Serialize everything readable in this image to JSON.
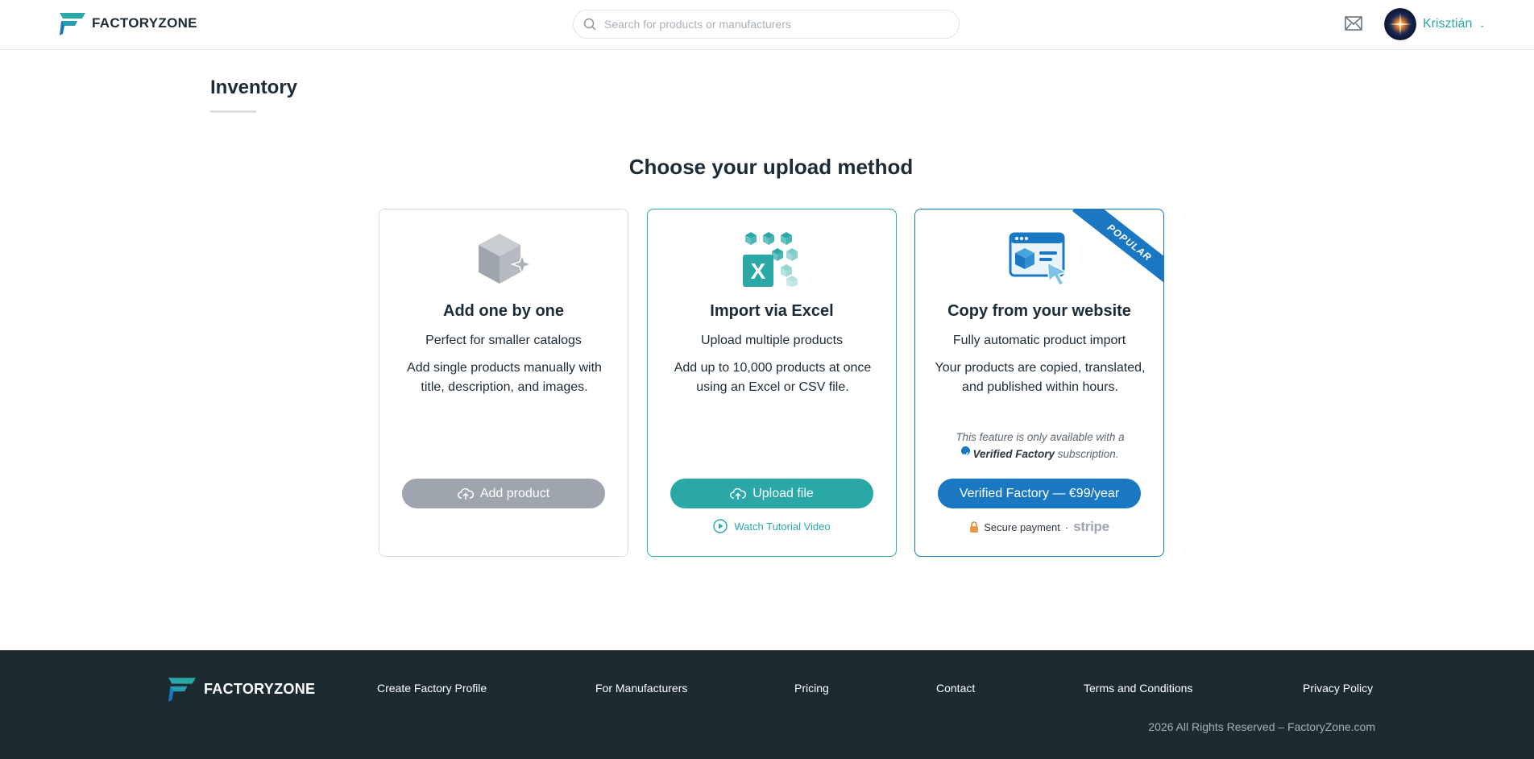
{
  "header": {
    "logo_text": "FACTORYZONE",
    "search_placeholder": "Search for products or manufacturers",
    "user_name": "Krisztián"
  },
  "page": {
    "title": "Inventory",
    "heading": "Choose your upload method"
  },
  "cards": [
    {
      "title": "Add one by one",
      "subtitle": "Perfect for smaller catalogs",
      "description": "Add single products manually with title, description, and images.",
      "button_label": "Add product"
    },
    {
      "title": "Import via Excel",
      "subtitle": "Upload multiple products",
      "description": "Add up to 10,000 products at once using an Excel or CSV file.",
      "button_label": "Upload file",
      "link_label": "Watch Tutorial Video"
    },
    {
      "title": "Copy from your website",
      "subtitle": "Fully automatic product import",
      "description": "Your products are copied, translated, and published within hours.",
      "note_prefix": "This feature is only available with a",
      "note_bold": "Verified Factory",
      "note_suffix": "subscription.",
      "button_label": "Verified Factory — €99/year",
      "secure_label": "Secure payment",
      "separator": "·",
      "payment_brand": "stripe",
      "ribbon": "POPULAR"
    }
  ],
  "footer": {
    "logo_text": "FACTORYZONE",
    "links": [
      "Create Factory Profile",
      "For Manufacturers",
      "Pricing",
      "Contact",
      "Terms and Conditions",
      "Privacy Policy"
    ],
    "copyright": "2026 All Rights Reserved – FactoryZone.com"
  },
  "colors": {
    "brand_teal": "#2aa8a8",
    "brand_blue": "#1a78c2",
    "footer_bg": "#1c2b32",
    "disabled_gray": "#9ea5ae"
  }
}
